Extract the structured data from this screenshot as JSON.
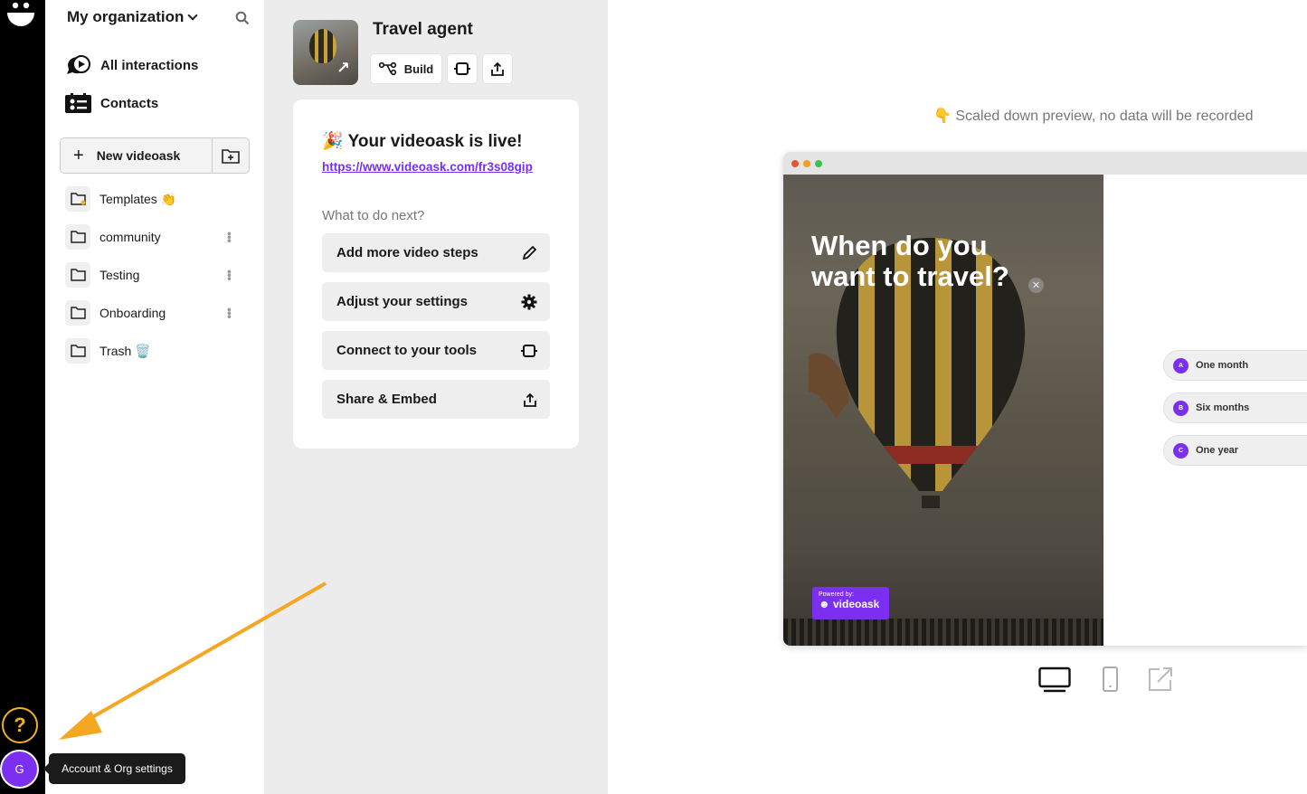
{
  "rail": {
    "help_glyph": "?",
    "avatar_letter": "G"
  },
  "sidebar": {
    "org_name": "My organization",
    "nav": [
      {
        "label": "All interactions",
        "icon": "video-chat-icon"
      },
      {
        "label": "Contacts",
        "icon": "contacts-icon"
      }
    ],
    "new_button": "New videoask",
    "folders": [
      {
        "label": "Templates",
        "emoji": "👏"
      },
      {
        "label": "community"
      },
      {
        "label": "Testing"
      },
      {
        "label": "Onboarding"
      },
      {
        "label": "Trash",
        "emoji": "🗑️"
      }
    ]
  },
  "project": {
    "title": "Travel agent",
    "build_label": "Build"
  },
  "live_card": {
    "emoji": "🎉",
    "title": "Your videoask is live!",
    "link": "https://www.videoask.com/fr3s08gip",
    "next_label": "What to do next?",
    "actions": [
      {
        "label": "Add more video steps",
        "icon": "pencil-icon"
      },
      {
        "label": "Adjust your settings",
        "icon": "gear-icon"
      },
      {
        "label": "Connect to your tools",
        "icon": "plug-icon"
      },
      {
        "label": "Share & Embed",
        "icon": "share-icon"
      }
    ]
  },
  "preview": {
    "note_emoji": "👇",
    "note": "Scaled down preview, no data will be recorded",
    "question": "When do you want to travel?",
    "powered_small": "Powered by:",
    "powered_brand": "videoask",
    "options": [
      {
        "key": "A",
        "label": "One month"
      },
      {
        "key": "B",
        "label": "Six months"
      },
      {
        "key": "C",
        "label": "One year"
      }
    ],
    "window_dots": [
      "#e8552f",
      "#f0a11c",
      "#3cc24a"
    ]
  },
  "tooltip": "Account & Org settings",
  "colors": {
    "accent": "#7b2ff0",
    "arrow": "#f5a623",
    "help_ring": "#f0b41c"
  }
}
